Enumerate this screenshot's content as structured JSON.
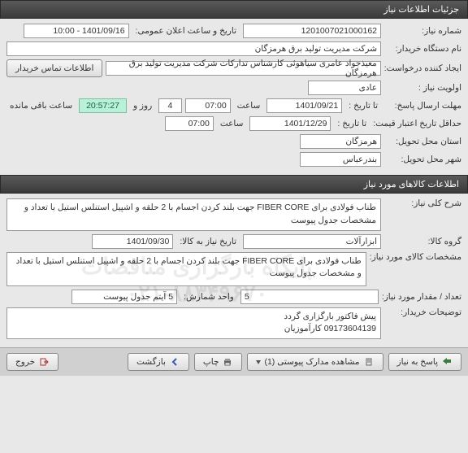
{
  "sections": {
    "need_details": "جزئیات اطلاعات نیاز",
    "goods_info": "اطلاعات کالاهای مورد نیاز"
  },
  "labels": {
    "need_number": "شماره نیاز:",
    "announce_datetime": "تاریخ و ساعت اعلان عمومی:",
    "buyer_name": "نام دستگاه خریدار:",
    "request_creator": "ایجاد کننده درخواست:",
    "contact_info": "اطلاعات تماس خریدار",
    "priority": "اولویت نیاز :",
    "response_deadline": "مهلت ارسال پاسخ:",
    "to_date": "تا تاریخ :",
    "hour": "ساعت",
    "days_and": "روز و",
    "hours_remaining": "ساعت باقی مانده",
    "min_validity": "حداقل تاریخ اعتبار قیمت:",
    "delivery_province": "استان محل تحویل:",
    "delivery_city": "شهر محل تحویل:",
    "general_description": "شرح کلی نیاز:",
    "goods_group": "گروه کالا:",
    "need_date": "تاریخ نیاز به کالا:",
    "goods_spec": "مشخصات کالای مورد نیاز:",
    "quantity": "تعداد / مقدار مورد نیاز:",
    "count_unit": "واحد شمارش:",
    "buyer_notes": "توضیحات خریدار:"
  },
  "values": {
    "need_number": "1201007021000162",
    "announce_datetime": "1401/09/16 - 10:00",
    "buyer_name": "شرکت مدیریت تولید برق هرمزگان",
    "request_creator": "معیذجواد عامری سیاهوئی کارشناس تدارکات شرکت مدیریت تولید برق هرمزگان",
    "priority": "عادی",
    "response_to_date": "1401/09/21",
    "response_hour": "07:00",
    "remaining_days": "4",
    "countdown": "20:57:27",
    "validity_to_date": "1401/12/29",
    "validity_hour": "07:00",
    "delivery_province": "هرمزگان",
    "delivery_city": "بندرعباس",
    "general_description": "طناب فولادی برای FIBER CORE جهت بلند کردن اجسام با 2 حلقه و اشپیل استنلس استیل با تعداد و مشخصات جدول پیوست",
    "goods_group": "ابزارآلات",
    "need_date": "1401/09/30",
    "goods_spec": "طناب فولادی برای FIBER CORE جهت بلند کردن اجسام با 2 حلقه و اشپیل استنلس استیل با تعداد و مشخصات جدول پیوست",
    "quantity": "5",
    "count_unit": "5 آیتم جدول پیوست",
    "buyer_notes": "پیش فاکتور بارگزاری گردد\n09173604139 کارآموزیان"
  },
  "buttons": {
    "respond": "پاسخ به نیاز",
    "attachments": "مشاهده مدارک پیوستی (1)",
    "print": "چاپ",
    "back": "بازگشت",
    "exit": "خروج"
  },
  "watermark": "پایگاه بارگزاری مناقصات\n۰۲۱-۸۸۳۴۹۶۷۰"
}
